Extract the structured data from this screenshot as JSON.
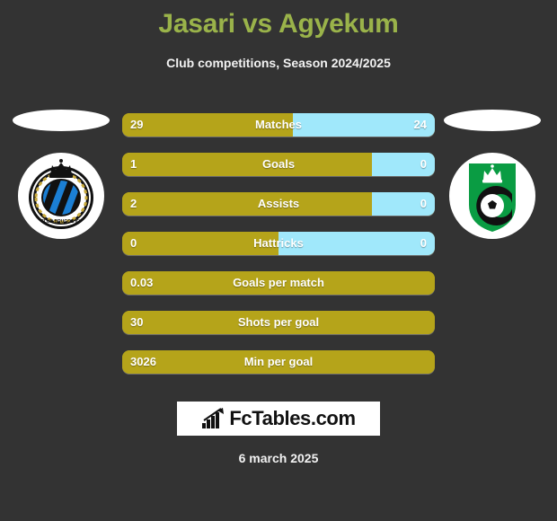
{
  "header": {
    "title": "Jasari vs Agyekum",
    "subtitle": "Club competitions, Season 2024/2025",
    "title_color": "#9ab34a"
  },
  "colors": {
    "background": "#333333",
    "home_bar": "#b5a41a",
    "away_bar": "#a0e8fb",
    "text": "#ffffff"
  },
  "teams": {
    "home": {
      "crest_name": "club-brugge-crest",
      "crest_colors": [
        "#0b54a0",
        "#111111",
        "#ffffff",
        "#c8a93a"
      ]
    },
    "away": {
      "crest_name": "cercle-brugge-crest",
      "crest_colors": [
        "#0a9c43",
        "#111111",
        "#ffffff"
      ]
    }
  },
  "stats": [
    {
      "label": "Matches",
      "home": "29",
      "away": "24",
      "home_pct": 54.7,
      "split": true
    },
    {
      "label": "Goals",
      "home": "1",
      "away": "0",
      "home_pct": 80.0,
      "split": true
    },
    {
      "label": "Assists",
      "home": "2",
      "away": "0",
      "home_pct": 80.0,
      "split": true
    },
    {
      "label": "Hattricks",
      "home": "0",
      "away": "0",
      "home_pct": 50.0,
      "split": true
    },
    {
      "label": "Goals per match",
      "home": "0.03",
      "away": "",
      "home_pct": 100,
      "split": false
    },
    {
      "label": "Shots per goal",
      "home": "30",
      "away": "",
      "home_pct": 100,
      "split": false
    },
    {
      "label": "Min per goal",
      "home": "3026",
      "away": "",
      "home_pct": 100,
      "split": false
    }
  ],
  "footer": {
    "brand": "FcTables.com",
    "brand_icon": "bar-chart-arrow-icon",
    "date": "6 march 2025"
  }
}
